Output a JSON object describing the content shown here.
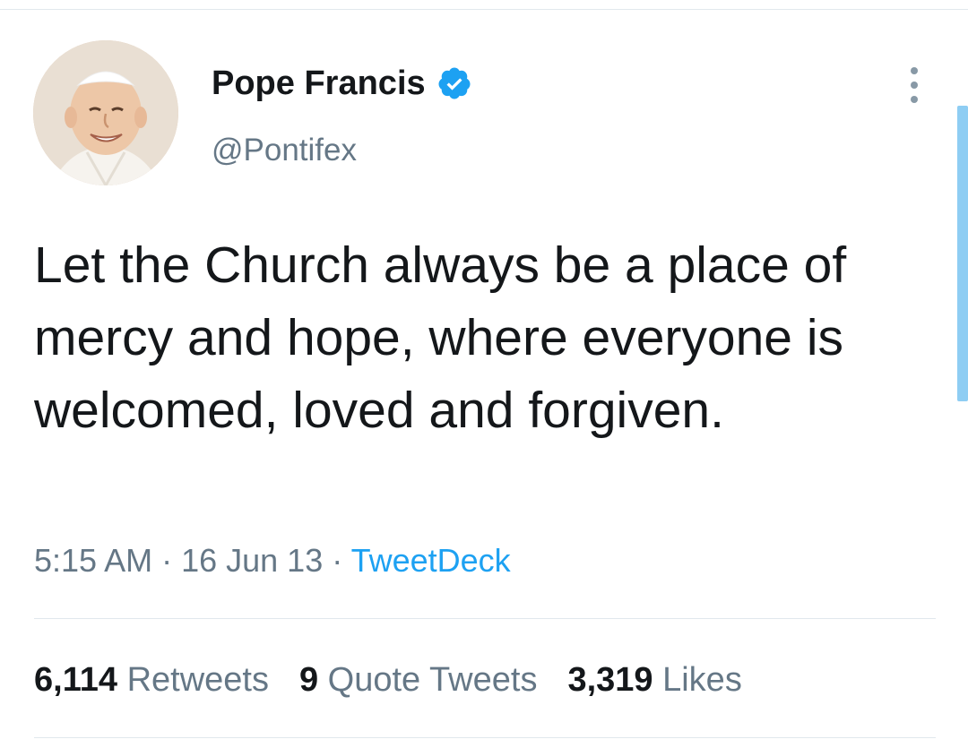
{
  "author": {
    "display_name": "Pope Francis",
    "handle": "@Pontifex",
    "verified": true,
    "avatar_icon": "profile-photo"
  },
  "tweet": {
    "text": "Let the Church always be a place of mercy and hope, where everyone is welcomed, loved and forgiven.",
    "time": "5:15 AM",
    "date": "16 Jun 13",
    "source": "TweetDeck",
    "separator": " · "
  },
  "stats": {
    "retweets": {
      "count": "6,114",
      "label": "Retweets"
    },
    "quote_tweets": {
      "count": "9",
      "label": "Quote Tweets"
    },
    "likes": {
      "count": "3,319",
      "label": "Likes"
    }
  },
  "colors": {
    "text": "#14171a",
    "secondary": "#657786",
    "accent": "#1da1f2",
    "divider": "#e1e8ed"
  },
  "icons": {
    "more": "more-vertical-icon",
    "verified": "verified-badge-icon"
  }
}
